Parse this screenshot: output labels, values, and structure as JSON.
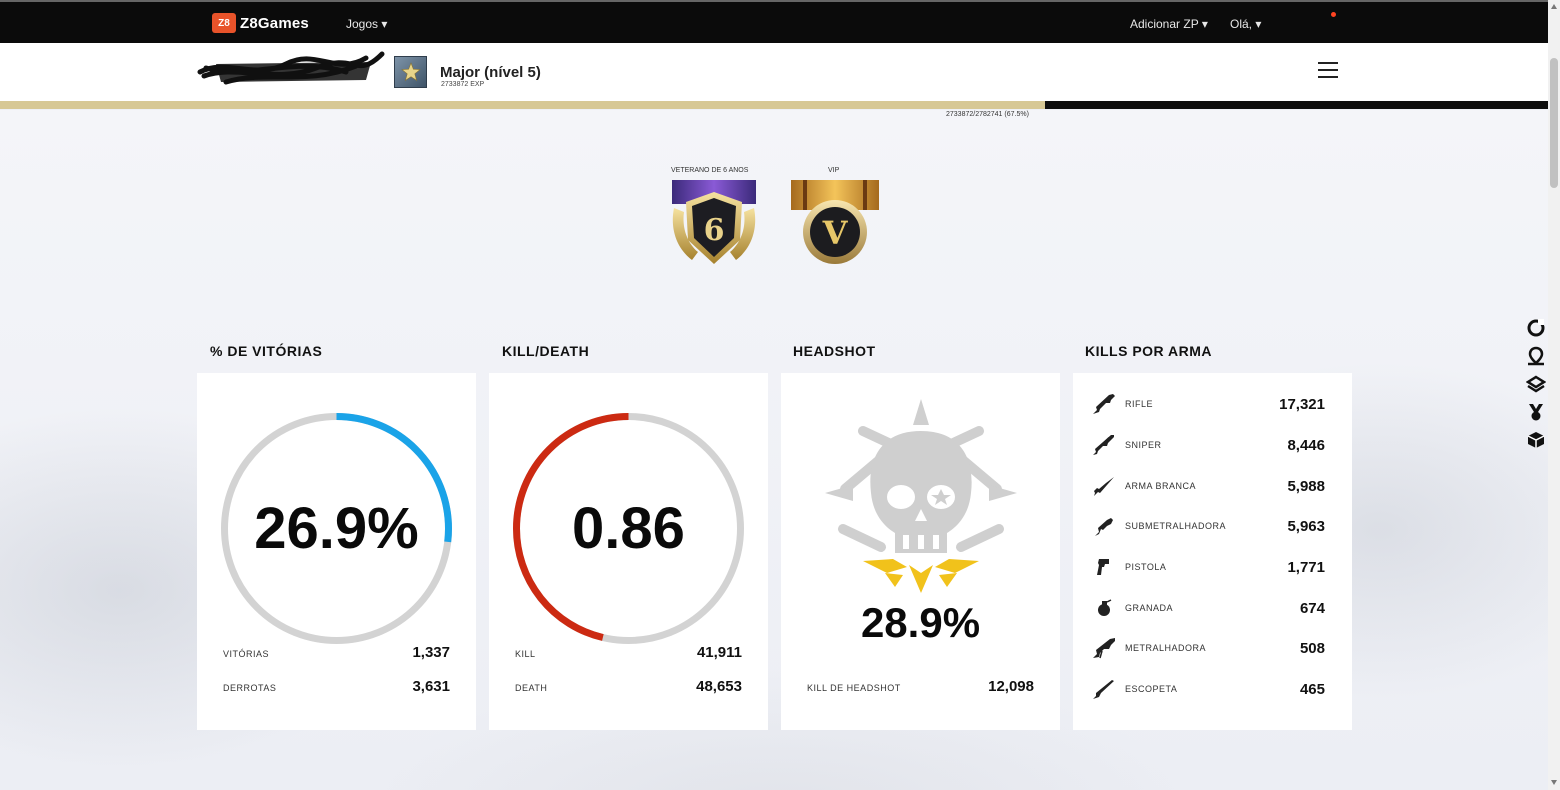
{
  "nav": {
    "brand_logo": "Z8",
    "brand": "Z8Games",
    "games": "Jogos ▾",
    "add_zp": "Adicionar ZP ▾",
    "greeting": "Olá, ▾"
  },
  "profile": {
    "rank_title": "Major (nível 5)",
    "exp": "2733872 EXP",
    "xp_progress": "2733872/2782741 (67.5%)",
    "xp_fraction": 0.675
  },
  "badges": [
    {
      "label": "VETERANO DE 6 ANOS",
      "glyph": "6"
    },
    {
      "label": "VIP",
      "glyph": "V"
    }
  ],
  "sections": {
    "wins": {
      "title": "% DE VITÓRIAS",
      "value": "26.9%",
      "fraction": 0.269,
      "color": "#1aa3e8",
      "rows": [
        {
          "label": "VITÓRIAS",
          "value": "1,337"
        },
        {
          "label": "DERROTAS",
          "value": "3,631"
        }
      ]
    },
    "kd": {
      "title": "KILL/DEATH",
      "value": "0.86",
      "fraction": 0.463,
      "color": "#cc2a12",
      "rows": [
        {
          "label": "KILL",
          "value": "41,911"
        },
        {
          "label": "DEATH",
          "value": "48,653"
        }
      ]
    },
    "headshot": {
      "title": "HEADSHOT",
      "value": "28.9%",
      "row": {
        "label": "KILL DE HEADSHOT",
        "value": "12,098"
      }
    },
    "weapons": {
      "title": "KILLS POR ARMA",
      "items": [
        {
          "label": "RIFLE",
          "value": "17,321",
          "icon": "rifle-icon"
        },
        {
          "label": "SNIPER",
          "value": "8,446",
          "icon": "sniper-icon"
        },
        {
          "label": "ARMA BRANCA",
          "value": "5,988",
          "icon": "knife-icon"
        },
        {
          "label": "SUBMETRALHADORA",
          "value": "5,963",
          "icon": "smg-icon"
        },
        {
          "label": "PISTOLA",
          "value": "1,771",
          "icon": "pistol-icon"
        },
        {
          "label": "GRANADA",
          "value": "674",
          "icon": "grenade-icon"
        },
        {
          "label": "METRALHADORA",
          "value": "508",
          "icon": "machine-gun-icon"
        },
        {
          "label": "ESCOPETA",
          "value": "465",
          "icon": "shotgun-icon"
        }
      ]
    }
  },
  "side_icons": [
    "refresh-icon",
    "location-icon",
    "layers-icon",
    "medal-icon",
    "box-icon"
  ]
}
